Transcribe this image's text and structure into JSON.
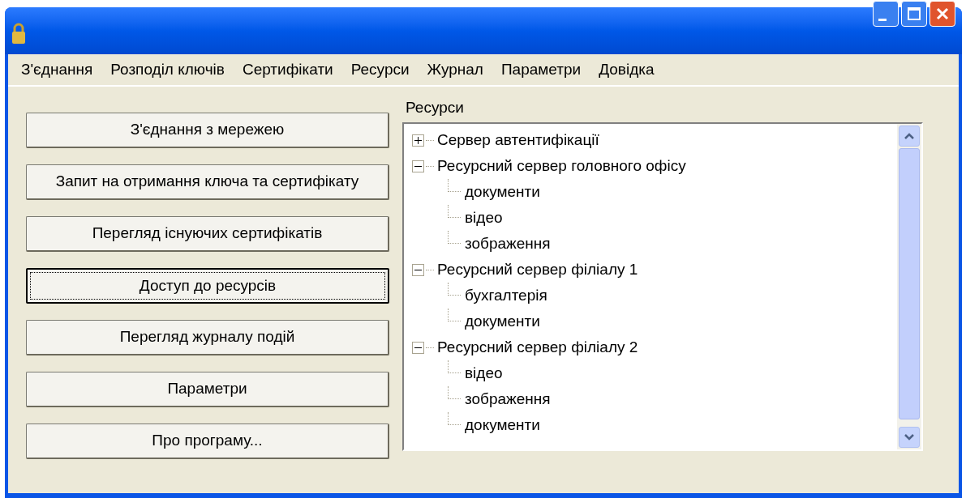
{
  "menu": [
    {
      "label": "З'єднання"
    },
    {
      "label": "Розподіл ключів"
    },
    {
      "label": "Сертифікати"
    },
    {
      "label": "Ресурси"
    },
    {
      "label": "Журнал"
    },
    {
      "label": "Параметри"
    },
    {
      "label": "Довідка"
    }
  ],
  "buttons": [
    {
      "label": "З'єднання з мережею",
      "focused": false
    },
    {
      "label": "Запит на отримання ключа та сертифікату",
      "focused": false
    },
    {
      "label": "Перегляд існуючих сертифікатів",
      "focused": false
    },
    {
      "label": "Доступ до ресурсів",
      "focused": true
    },
    {
      "label": "Перегляд журналу подій",
      "focused": false
    },
    {
      "label": "Параметри",
      "focused": false
    },
    {
      "label": "Про програму...",
      "focused": false
    }
  ],
  "resources": {
    "label": "Ресурси",
    "tree": [
      {
        "label": "Сервер автентифікації",
        "expanded": false
      },
      {
        "label": "Ресурсний сервер головного офісу",
        "expanded": true,
        "children": [
          {
            "label": "документи"
          },
          {
            "label": "відео"
          },
          {
            "label": "зображення"
          }
        ]
      },
      {
        "label": "Ресурсний сервер філіалу 1",
        "expanded": true,
        "children": [
          {
            "label": "бухгалтерія"
          },
          {
            "label": "документи"
          }
        ]
      },
      {
        "label": "Ресурсний сервер філіалу 2",
        "expanded": true,
        "children": [
          {
            "label": "відео"
          },
          {
            "label": "зображення"
          },
          {
            "label": "документи"
          }
        ]
      }
    ]
  }
}
